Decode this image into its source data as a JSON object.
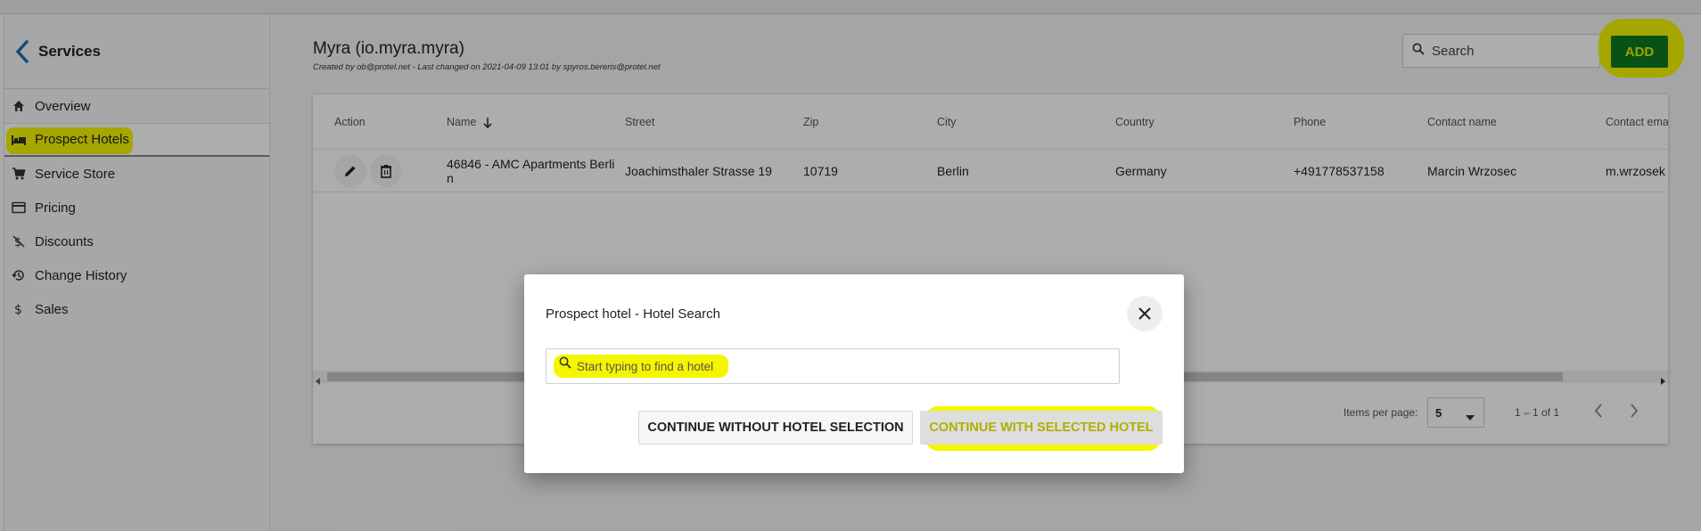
{
  "sidebar": {
    "title": "Services",
    "items": [
      {
        "label": "Overview",
        "icon": "home-icon"
      },
      {
        "label": "Prospect Hotels",
        "icon": "bed-icon"
      },
      {
        "label": "Service Store",
        "icon": "cart-icon"
      },
      {
        "label": "Pricing",
        "icon": "credit-card-icon"
      },
      {
        "label": "Discounts",
        "icon": "money-off-icon"
      },
      {
        "label": "Change History",
        "icon": "history-icon"
      },
      {
        "label": "Sales",
        "icon": "dollar-icon"
      }
    ]
  },
  "header": {
    "title": "Myra (io.myra.myra)",
    "subtitle": "Created by ob@protel.net - Last changed on 2021-04-09 13:01 by spyros.bereris@protel.net",
    "search_placeholder": "Search",
    "add_label": "ADD"
  },
  "table": {
    "columns": [
      "Action",
      "Name",
      "Street",
      "Zip",
      "City",
      "Country",
      "Phone",
      "Contact name",
      "Contact ema"
    ],
    "rows": [
      {
        "name_line1": "46846 - AMC Apartments Berli",
        "name_line2": "n",
        "street": "Joachimsthaler Strasse 19",
        "zip": "10719",
        "city": "Berlin",
        "country": "Germany",
        "phone": "+491778537158",
        "contact_name": "Marcin Wrzosec",
        "contact_email": "m.wrzosek"
      }
    ]
  },
  "paginator": {
    "items_per_page_label": "Items per page:",
    "items_per_page_value": "5",
    "range": "1 – 1 of 1"
  },
  "dialog": {
    "title": "Prospect hotel - Hotel Search",
    "search_placeholder": "Start typing to find a hotel",
    "btn_without": "CONTINUE WITHOUT HOTEL SELECTION",
    "btn_with": "CONTINUE WITH SELECTED HOTEL"
  },
  "colors": {
    "highlight": "#f5f500",
    "add_button": "#0c7a1f",
    "overlay": "rgba(0,0,0,0.32)"
  }
}
